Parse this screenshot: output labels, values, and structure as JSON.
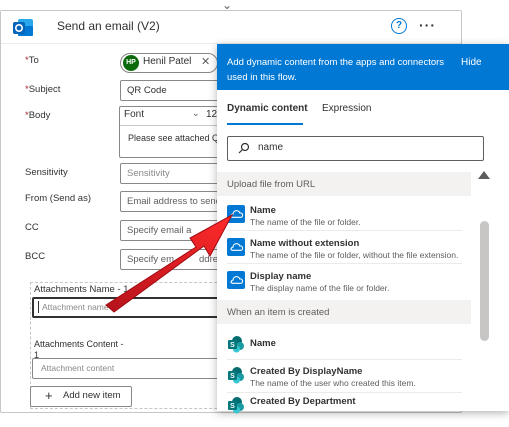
{
  "card": {
    "title": "Send an email (V2)",
    "help_symbol": "?",
    "more_symbol": "···",
    "top_arrow": "⌄"
  },
  "fields": {
    "to_label": "To",
    "to_chip_initials": "HP",
    "to_chip_name": "Henil Patel",
    "to_chip_remove": "✕",
    "subject_label": "Subject",
    "subject_value": "QR Code",
    "body_label": "Body",
    "body_font": "Font",
    "body_font_size": "12",
    "body_text": "Please see attached QR",
    "sensitivity_label": "Sensitivity",
    "sensitivity_placeholder": "Sensitivity",
    "from_label": "From (Send as)",
    "from_placeholder": "Email address to send",
    "cc_label": "CC",
    "cc_placeholder": "Specify email a",
    "bcc_label": "BCC",
    "bcc_placeholder": "Specify em",
    "bcc_placeholder_tail": "ddres",
    "attach_name_label": "Attachments Name - 1",
    "attach_name_placeholder": "Attachment name",
    "attach_content_label": "Attachments Content -",
    "attach_content_label_2": "1",
    "attach_content_placeholder": "Attachment content",
    "add_item_label": "Add new item"
  },
  "panel": {
    "header_text": "Add dynamic content from the apps and connectors used in this flow.",
    "hide_label": "Hide",
    "tabs": [
      "Dynamic content",
      "Expression"
    ],
    "search_value": "name",
    "groups": [
      {
        "title": "Upload file from URL",
        "items": [
          {
            "title": "Name",
            "desc": "The name of the file or folder."
          },
          {
            "title": "Name without extension",
            "desc": "The name of the file or folder, without the file extension."
          },
          {
            "title": "Display name",
            "desc": "The display name of the file or folder."
          }
        ]
      },
      {
        "title": "When an item is created",
        "items": [
          {
            "title": "Name",
            "desc": ""
          },
          {
            "title": "Created By DisplayName",
            "desc": "The name of the user who created this item."
          },
          {
            "title": "Created By Department",
            "desc": ""
          }
        ]
      }
    ]
  },
  "colors": {
    "accent": "#0078d4",
    "arrow": "#e81123"
  }
}
